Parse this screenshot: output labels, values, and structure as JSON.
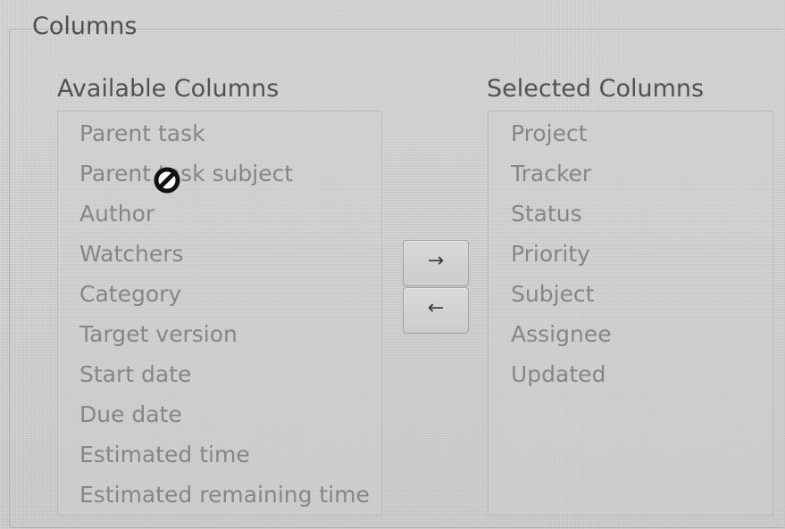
{
  "section": {
    "legend": "Columns"
  },
  "available": {
    "header": "Available Columns",
    "items": [
      "Parent task",
      "Parent task subject",
      "Author",
      "Watchers",
      "Category",
      "Target version",
      "Start date",
      "Due date",
      "Estimated time",
      "Estimated remaining time"
    ]
  },
  "selected": {
    "header": "Selected Columns",
    "items": [
      "Project",
      "Tracker",
      "Status",
      "Priority",
      "Subject",
      "Assignee",
      "Updated"
    ]
  },
  "buttons": {
    "add_symbol": "→",
    "remove_symbol": "←"
  },
  "icons": {
    "cursor": "not-allowed-cursor-icon"
  }
}
